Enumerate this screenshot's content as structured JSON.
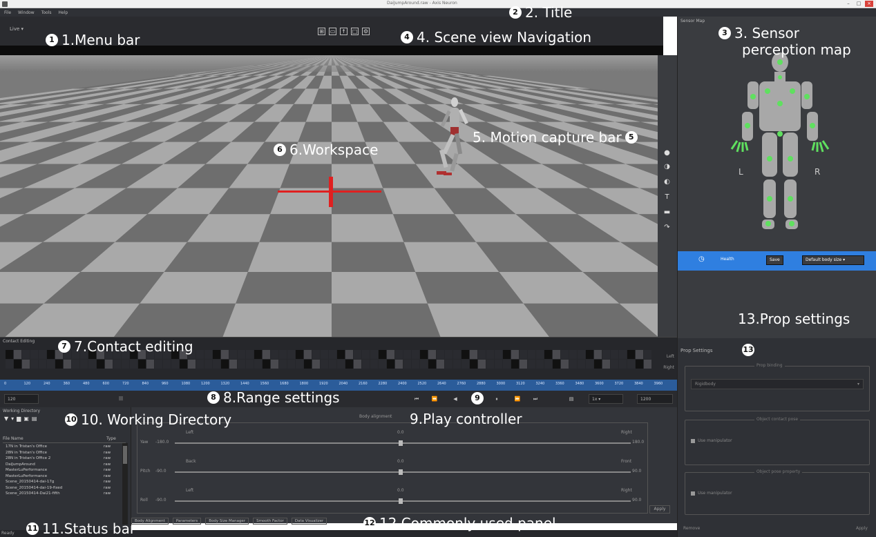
{
  "app": {
    "window_title": "DaiJumpAround.raw - Axis Neuron",
    "menu": [
      "File",
      "Window",
      "Tools",
      "Help"
    ],
    "window_buttons": [
      "–",
      "□",
      "×"
    ],
    "toolbar_combo": "Live",
    "nav_icons": [
      "grid-icon",
      "camera-icon",
      "figure-icon",
      "frame-icon",
      "settings-icon"
    ]
  },
  "sensor_panel": {
    "header": "Sensor Map",
    "left_label": "L",
    "right_label": "R",
    "bar_label": "Health",
    "save_label": "Save",
    "body_size": "Default body size"
  },
  "prop_panel": {
    "header": "Prop Settings",
    "groups": [
      {
        "title": "Prop binding",
        "value": "Rigidbody"
      },
      {
        "title": "Object contact pose",
        "checkbox": "Use manipulator"
      },
      {
        "title": "Object pose property",
        "checkbox": "Use manipulator"
      }
    ],
    "footer_left": "Remove",
    "footer_right": "Apply"
  },
  "contact": {
    "header": "Contact Editing",
    "side_labels": [
      "Left",
      "Right"
    ]
  },
  "timeline": {
    "ticks": [
      "0",
      "120",
      "240",
      "360",
      "480",
      "600",
      "720",
      "840",
      "960",
      "1080",
      "1200",
      "1320",
      "1440",
      "1560",
      "1680",
      "1800",
      "1920",
      "2040",
      "2160",
      "2280",
      "2400",
      "2520",
      "2640",
      "2760",
      "2880",
      "3000",
      "3120",
      "3240",
      "3360",
      "3480",
      "3600",
      "3720",
      "3840",
      "3960"
    ]
  },
  "controls": {
    "start_value": "120",
    "range_marker": "|||",
    "play_buttons": [
      "⏮",
      "⏪",
      "◀",
      "⏸",
      "⏩",
      "⏭"
    ],
    "speed": "1x",
    "end_value": "1200"
  },
  "workdir": {
    "header": "Working Directory",
    "tools": [
      "▼",
      "▾",
      "▆",
      "▣",
      "▤"
    ],
    "col_name": "File Name",
    "col_type": "Type",
    "files": [
      {
        "name": "17N in Tristan's Office",
        "type": "raw"
      },
      {
        "name": "28N in Tristan's Office",
        "type": "raw"
      },
      {
        "name": "28N in Tristan's Office 2",
        "type": "raw"
      },
      {
        "name": "DaiJumpAround",
        "type": "raw"
      },
      {
        "name": "MasterLuPerformance",
        "type": "raw"
      },
      {
        "name": "MasterLuPerformance",
        "type": "raw"
      },
      {
        "name": "Scene_20150414-dai-17g",
        "type": "raw"
      },
      {
        "name": "Scene_20150414-dai-19-fixed",
        "type": "raw"
      },
      {
        "name": "Scene_20150414-Dai21-fifth",
        "type": "raw"
      }
    ]
  },
  "common": {
    "group_title": "Body alignment",
    "rows": [
      {
        "axis": "Yaw",
        "value": "-180.0",
        "left": "Left",
        "center": "0.0",
        "right": "Right",
        "end": "180.0"
      },
      {
        "axis": "Pitch",
        "value": "-90.0",
        "left": "Back",
        "center": "0.0",
        "right": "Front",
        "end": "90.0"
      },
      {
        "axis": "Roll",
        "value": "-90.0",
        "left": "Left",
        "center": "0.0",
        "right": "Right",
        "end": "90.0"
      }
    ],
    "apply": "Apply",
    "tabs": [
      "Body Alignment",
      "Parameters",
      "Body Size Manager",
      "Smooth Factor",
      "Data Visualizer"
    ]
  },
  "status": {
    "ready": "Ready"
  },
  "callouts": [
    {
      "num": "1",
      "label": "1.Menu bar"
    },
    {
      "num": "2",
      "label": "2. Title"
    },
    {
      "num": "3",
      "label": "3. Sensor"
    },
    {
      "num": "",
      "label": "perception map"
    },
    {
      "num": "4",
      "label": "4. Scene view Navigation"
    },
    {
      "num": "5",
      "label": "5. Motion capture bar"
    },
    {
      "num": "6",
      "label": "6.Workspace"
    },
    {
      "num": "7",
      "label": "7.Contact editing"
    },
    {
      "num": "8",
      "label": "8.Range settings"
    },
    {
      "num": "9",
      "label": "9.Play controller"
    },
    {
      "num": "10",
      "label": "10. Working Directory"
    },
    {
      "num": "11",
      "label": "11.Status bar"
    },
    {
      "num": "12",
      "label": "12.Commonly used panel"
    },
    {
      "num": "13",
      "label": "13.Prop settings"
    }
  ],
  "colors": {
    "accent_blue": "#2f7fe0",
    "sensor_green": "#5fe05f",
    "marker_red": "#e02020",
    "timeline_blue": "#2b5c9a"
  }
}
